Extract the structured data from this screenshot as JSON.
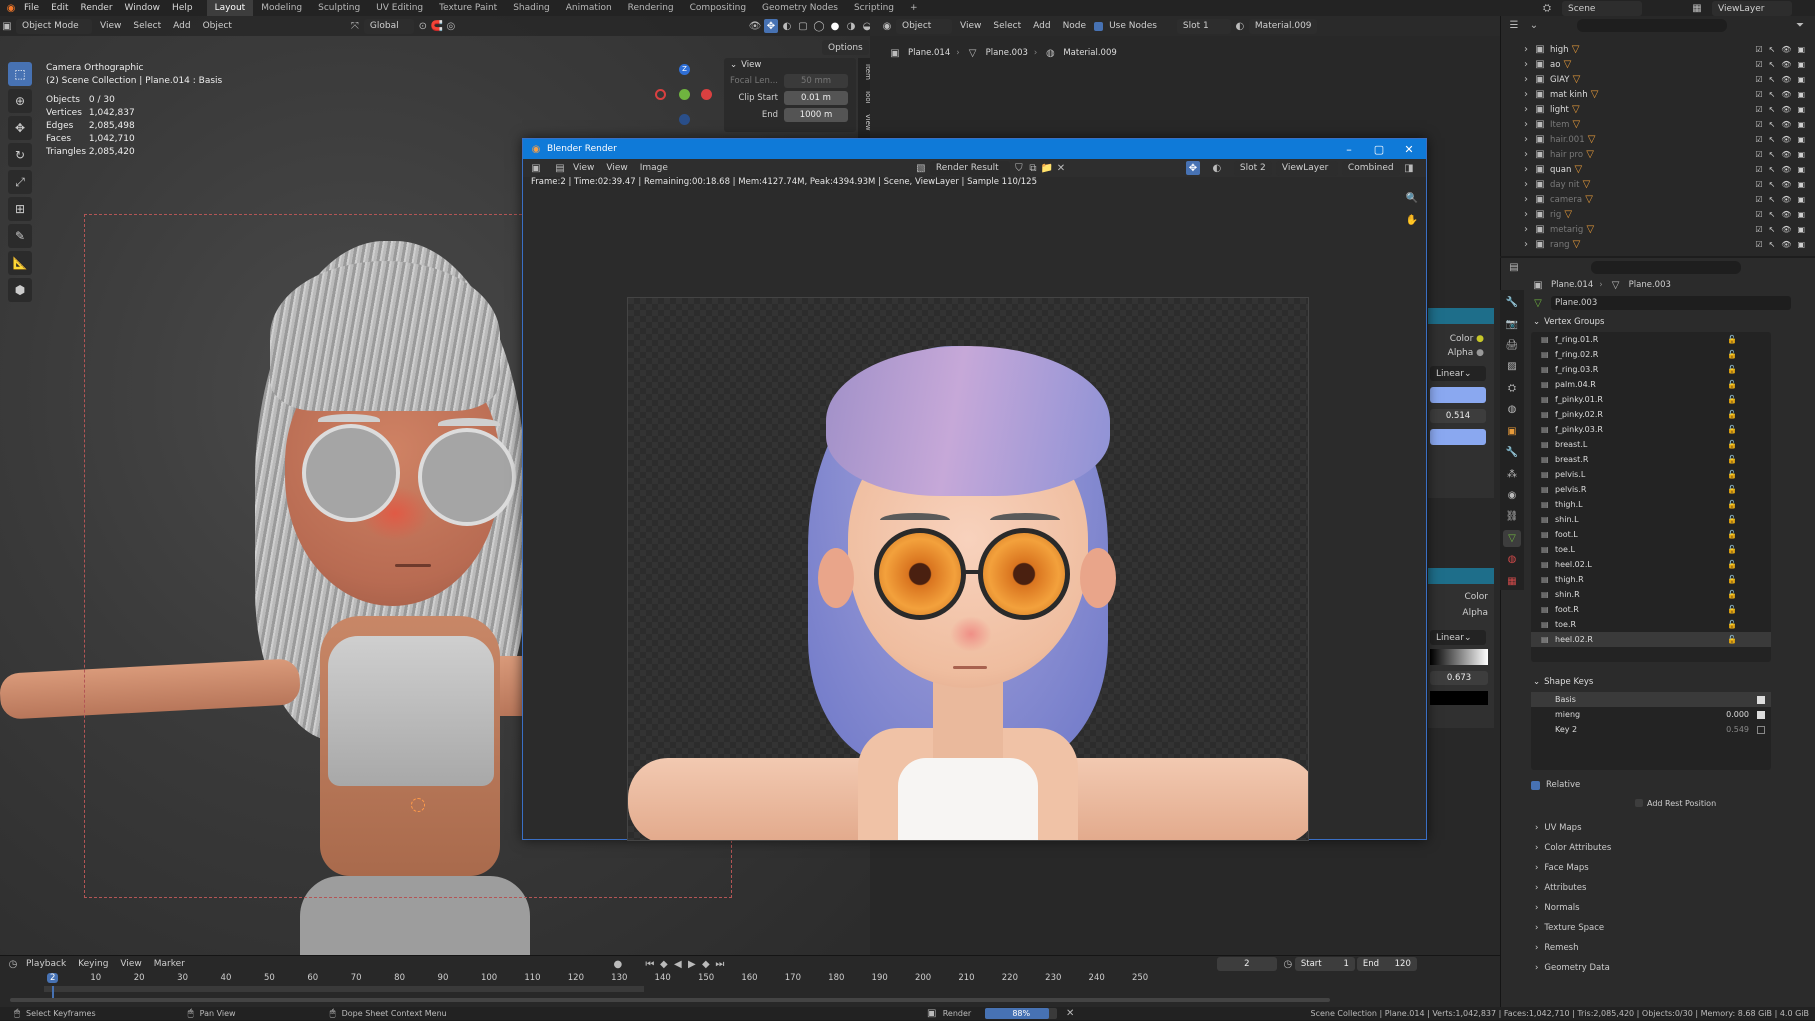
{
  "topbar": {
    "menus": [
      "File",
      "Edit",
      "Render",
      "Window",
      "Help"
    ],
    "workspaces": [
      "Layout",
      "Modeling",
      "Sculpting",
      "UV Editing",
      "Texture Paint",
      "Shading",
      "Animation",
      "Rendering",
      "Compositing",
      "Geometry Nodes",
      "Scripting"
    ],
    "active_workspace": "Layout",
    "scene_label": "Scene",
    "viewlayer_label": "ViewLayer"
  },
  "viewport": {
    "mode": "Object Mode",
    "menu": [
      "View",
      "Select",
      "Add",
      "Object"
    ],
    "orientation": "Global",
    "options_label": "Options",
    "view_title": "Camera Orthographic",
    "collection_line": "(2) Scene Collection | Plane.014 : Basis",
    "stats": [
      {
        "k": "Objects",
        "v": "0 / 30"
      },
      {
        "k": "Vertices",
        "v": "1,042,837"
      },
      {
        "k": "Edges",
        "v": "2,085,498"
      },
      {
        "k": "Faces",
        "v": "1,042,710"
      },
      {
        "k": "Triangles",
        "v": "2,085,420"
      }
    ],
    "npanel": {
      "title": "View",
      "focal_label": "Focal Len...",
      "focal_value": "50 mm",
      "clip_start_label": "Clip Start",
      "clip_start_value": "0.01 m",
      "end_label": "End",
      "end_value": "1000 m",
      "tabs": [
        "Item",
        "Tool",
        "View"
      ]
    }
  },
  "shader_editor": {
    "menu_object": "Object",
    "menu": [
      "View",
      "Select",
      "Add",
      "Node"
    ],
    "use_nodes": "Use Nodes",
    "slot": "Slot 1",
    "material": "Material.009",
    "breadcrumb": [
      "Plane.014",
      "Plane.003",
      "Material.009"
    ],
    "color_label": "Color",
    "alpha_label": "Alpha",
    "linear_label": "Linear",
    "value_1": "0.514",
    "color_label_2": "Color",
    "alpha_label_2": "Alpha",
    "linear_label_2": "Linear",
    "value_2": "0.673"
  },
  "render_window": {
    "title": "Blender Render",
    "menu": [
      "View",
      "View",
      "Image"
    ],
    "result": "Render Result",
    "slot": "Slot 2",
    "view_layer": "ViewLayer",
    "pass": "Combined",
    "info": "Frame:2 | Time:02:39.47 | Remaining:00:18.68 | Mem:4127.74M, Peak:4394.93M | Scene, ViewLayer | Sample 110/125"
  },
  "outliner": {
    "items": [
      {
        "name": "high",
        "dim": false
      },
      {
        "name": "ao",
        "dim": false
      },
      {
        "name": "GIAY",
        "dim": false
      },
      {
        "name": "mat kinh",
        "dim": false
      },
      {
        "name": "light",
        "dim": false
      },
      {
        "name": "Item",
        "dim": true
      },
      {
        "name": "hair.001",
        "dim": true
      },
      {
        "name": "hair pro",
        "dim": true
      },
      {
        "name": "quan",
        "dim": false
      },
      {
        "name": "day nit",
        "dim": true
      },
      {
        "name": "camera",
        "dim": true
      },
      {
        "name": "rig",
        "dim": true
      },
      {
        "name": "metarig",
        "dim": true
      },
      {
        "name": "rang",
        "dim": true
      }
    ]
  },
  "properties": {
    "breadcrumb": [
      "Plane.014",
      "Plane.003"
    ],
    "mesh_name": "Plane.003",
    "vertex_groups_title": "Vertex Groups",
    "vertex_groups": [
      "f_ring.01.R",
      "f_ring.02.R",
      "f_ring.03.R",
      "palm.04.R",
      "f_pinky.01.R",
      "f_pinky.02.R",
      "f_pinky.03.R",
      "breast.L",
      "breast.R",
      "pelvis.L",
      "pelvis.R",
      "thigh.L",
      "shin.L",
      "foot.L",
      "toe.L",
      "heel.02.L",
      "thigh.R",
      "shin.R",
      "foot.R",
      "toe.R",
      "heel.02.R"
    ],
    "shape_keys_title": "Shape Keys",
    "shape_keys": [
      {
        "name": "Basis",
        "value": ""
      },
      {
        "name": "mieng",
        "value": "0.000"
      },
      {
        "name": "Key 2",
        "value": "0.549"
      }
    ],
    "relative_label": "Relative",
    "add_rest_label": "Add Rest Position",
    "collapsed": [
      "UV Maps",
      "Color Attributes",
      "Face Maps",
      "Attributes",
      "Normals",
      "Texture Space",
      "Remesh",
      "Geometry Data"
    ]
  },
  "timeline": {
    "menu": [
      "Playback",
      "Keying",
      "View",
      "Marker"
    ],
    "current_frame": "2",
    "start_label": "Start",
    "start_value": "1",
    "end_label": "End",
    "end_value": "120",
    "ticks": [
      "2",
      "10",
      "20",
      "30",
      "40",
      "50",
      "60",
      "70",
      "80",
      "90",
      "100",
      "110",
      "120",
      "130",
      "140",
      "150",
      "160",
      "170",
      "180",
      "190",
      "200",
      "210",
      "220",
      "230",
      "240",
      "250"
    ]
  },
  "statusbar": {
    "select": "Select Keyframes",
    "pan": "Pan View",
    "context": "Dope Sheet Context Menu",
    "render_label": "Render",
    "progress_text": "88%",
    "progress": 0.88,
    "info": "Scene Collection | Plane.014 | Verts:1,042,837 | Faces:1,042,710 | Tris:2,085,420 | Objects:0/30 | Memory: 8.68 GiB | 4.0 GiB"
  },
  "colors": {
    "accent": "#4772b3",
    "titlebar": "#0f7ad8",
    "object_green": "#6fb43f"
  }
}
